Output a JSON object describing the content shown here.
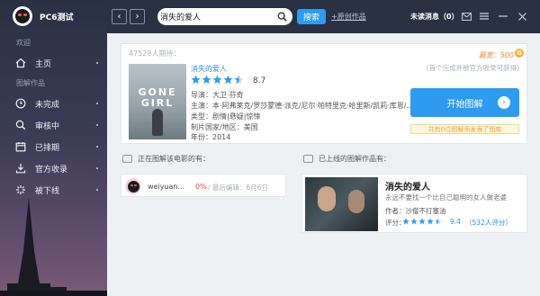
{
  "app": {
    "username": "PC6测试"
  },
  "sidebar": {
    "section_welcome": "欢迎",
    "home_label": "主页",
    "section_works": "图解作品",
    "items": [
      {
        "label": "未完成"
      },
      {
        "label": "审核中"
      },
      {
        "label": "已排期"
      },
      {
        "label": "官方收录"
      },
      {
        "label": "被下线"
      }
    ]
  },
  "topbar": {
    "search_value": "消失的爱人",
    "search_button": "搜索",
    "upload_link": "+原创作品",
    "unread_text": "未读消息（0）"
  },
  "movie": {
    "want_count": "47528人期待：",
    "title": "消失的爱人",
    "rating": "8.7",
    "stars_filled": 4.5,
    "director": "导演：大卫·芬奇",
    "cast": "主演：本·阿弗莱克/罗莎蒙德·派克/尼尔·帕特里克·哈里斯/凯莉·库恩/...",
    "genre": "类型：剧情|悬疑|惊悚",
    "region": "制片国家/地区：美国",
    "year": "年份：2014",
    "poster_text": "GONE GIRL"
  },
  "action_panel": {
    "limit": "最宽：500",
    "coin_glyph": "G",
    "limit_note": "(首个完成并被官方收录可获得)",
    "start_button": "开始图解",
    "exist_note": "共有0位图解师发表了图库"
  },
  "drawing_section": {
    "heading": "正在图解该电影的有：",
    "entries": [
      {
        "user": "weiyuan...",
        "progress": "0%",
        "date": "/ 最后编辑：6月6日"
      }
    ]
  },
  "works_section": {
    "heading": "已上线的图解作品有：",
    "works": [
      {
        "title": "消失的爱人",
        "desc": "永远不要找一个比自己聪明的女人做老婆",
        "author": "作者：沙僧不打塞油",
        "rating_label": "评分：",
        "score": "9.4",
        "count": "（532人评分）",
        "stars_filled": 4.5
      }
    ]
  },
  "colors": {
    "accent": "#2d9cf0",
    "star": "#2d9cf0",
    "topbar": "#2a3143",
    "progress": "#e5433f"
  }
}
